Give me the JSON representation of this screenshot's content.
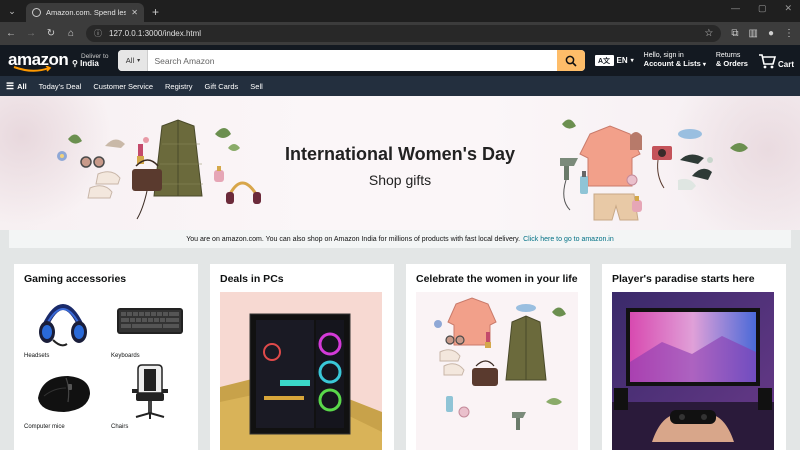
{
  "browser": {
    "tab_title": "Amazon.com. Spend less. Smile more.",
    "url": "127.0.0.1:3000/index.html"
  },
  "header": {
    "logo": "amazon",
    "deliver_label": "Deliver to",
    "deliver_location": "India",
    "search_category": "All",
    "search_placeholder": "Search Amazon",
    "lang_flag": "A文",
    "lang": "EN",
    "signin_line1": "Hello, sign in",
    "signin_line2": "Account & Lists",
    "returns_line1": "Returns",
    "returns_line2": "& Orders",
    "cart_label": "Cart"
  },
  "subnav": {
    "all_label": "All",
    "items": [
      "Today's Deal",
      "Customer Service",
      "Registry",
      "Gift Cards",
      "Sell"
    ]
  },
  "hero": {
    "title": "International Women's Day",
    "subtitle": "Shop gifts"
  },
  "notice": {
    "text": "You are on amazon.com. You can also shop on Amazon India for millions of products with fast local delivery.",
    "link": "Click here to go to amazon.in"
  },
  "cards": [
    {
      "title": "Gaming accessories",
      "items": [
        "Headsets",
        "Keyboards",
        "Computer mice",
        "Chairs"
      ]
    },
    {
      "title": "Deals in PCs"
    },
    {
      "title": "Celebrate the women in your life"
    },
    {
      "title": "Player's paradise starts here"
    }
  ],
  "colors": {
    "nav_bg": "#131921",
    "subnav_bg": "#232f3e",
    "search_button": "#febd69",
    "link": "#007185"
  }
}
